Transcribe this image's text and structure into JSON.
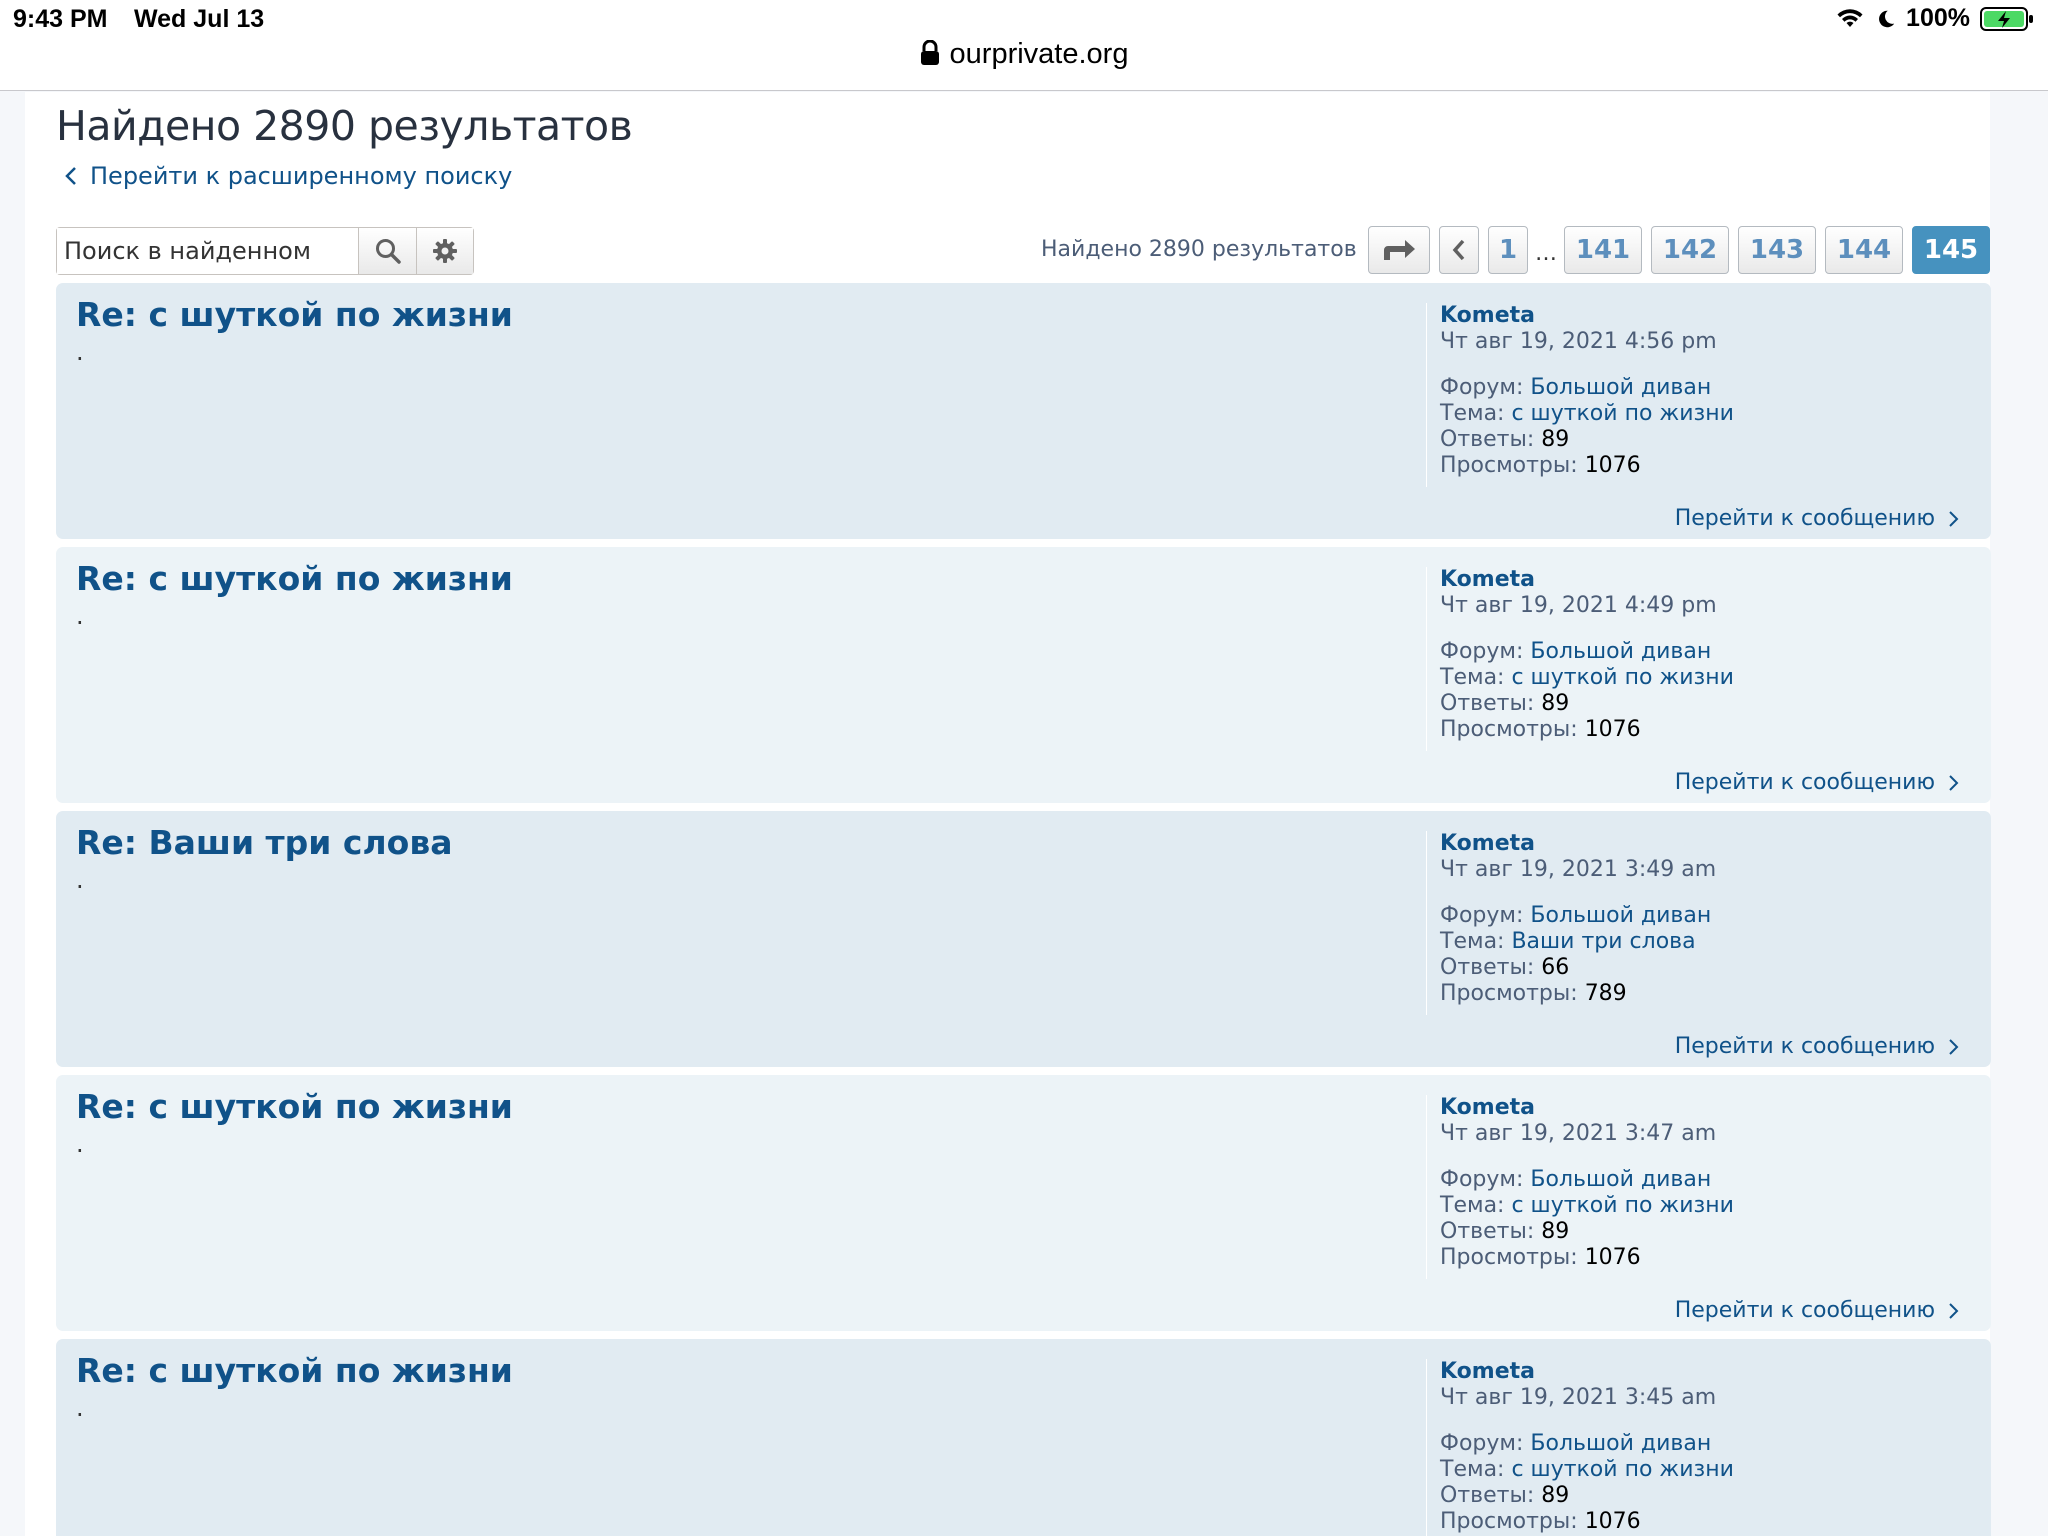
{
  "status_bar": {
    "time": "9:43 PM",
    "date": "Wed Jul 13",
    "battery": "100%",
    "wifi_icon": "wifi-icon",
    "moon_icon": "moon-icon",
    "battery_icon": "battery-charging-icon"
  },
  "address_bar": {
    "url": "ourprivate.org",
    "icon": "lock-icon"
  },
  "header": {
    "title": "Найдено 2890 результатов",
    "back_link": "Перейти к расширенному поиску"
  },
  "search": {
    "placeholder": "Поиск в найденном",
    "search_icon": "search-icon",
    "settings_icon": "gear-icon"
  },
  "pagination": {
    "results_count": "Найдено 2890 результатов",
    "jump_icon": "jump-arrow-icon",
    "prev_icon": "chevron-left-icon",
    "first": "1",
    "ellipsis": "…",
    "pages": [
      "141",
      "142",
      "143",
      "144"
    ],
    "current": "145"
  },
  "labels": {
    "forum": "Форум:",
    "topic": "Тема:",
    "replies": "Ответы:",
    "views": "Просмотры:",
    "jump": "Перейти к сообщению"
  },
  "results": [
    {
      "title": "Re: с шуткой по жизни",
      "body": ".",
      "author": "Kometa",
      "date": "Чт авг 19, 2021 4:56 pm",
      "forum": "Большой диван",
      "topic": "с шуткой по жизни",
      "replies": "89",
      "views": "1076"
    },
    {
      "title": "Re: с шуткой по жизни",
      "body": ".",
      "author": "Kometa",
      "date": "Чт авг 19, 2021 4:49 pm",
      "forum": "Большой диван",
      "topic": "с шуткой по жизни",
      "replies": "89",
      "views": "1076"
    },
    {
      "title": "Re: Ваши три слова",
      "body": ".",
      "author": "Kometa",
      "date": "Чт авг 19, 2021 3:49 am",
      "forum": "Большой диван",
      "topic": "Ваши три слова",
      "replies": "66",
      "views": "789"
    },
    {
      "title": "Re: с шуткой по жизни",
      "body": ".",
      "author": "Kometa",
      "date": "Чт авг 19, 2021 3:47 am",
      "forum": "Большой диван",
      "topic": "с шуткой по жизни",
      "replies": "89",
      "views": "1076"
    },
    {
      "title": "Re: с шуткой по жизни",
      "body": ".",
      "author": "Kometa",
      "date": "Чт авг 19, 2021 3:45 am",
      "forum": "Большой диван",
      "topic": "с шуткой по жизни",
      "replies": "89",
      "views": "1076"
    }
  ]
}
